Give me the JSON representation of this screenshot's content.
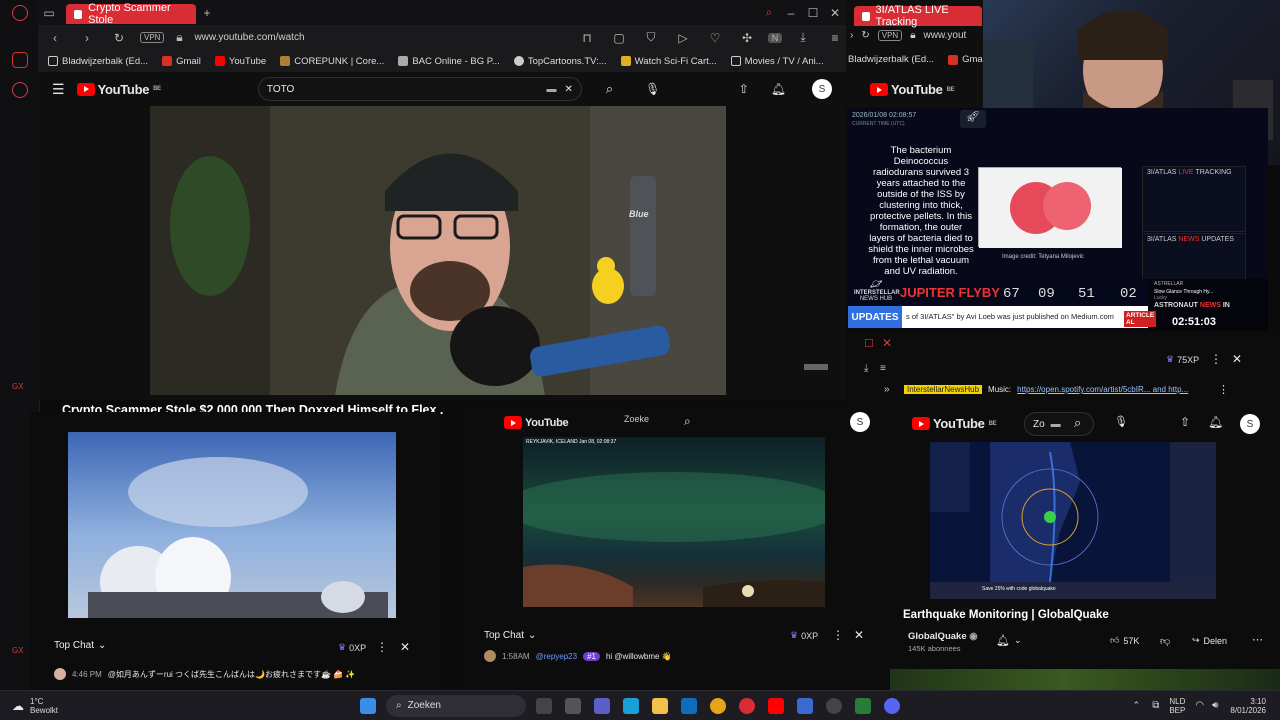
{
  "browser_main": {
    "tab_title": "Crypto Scammer Stole",
    "url": "www.youtube.com/watch",
    "vpn": "VPN",
    "bookmarks": [
      "Bladwijzerbalk (Ed...",
      "Gmail",
      "YouTube",
      "COREPUNK | Core...",
      "BAC Online - BG P...",
      "TopCartoons.TV:...",
      "Watch Sci-Fi Cart...",
      "Movies / TV / Ani..."
    ],
    "search_value": "TOTO",
    "avatar_letter": "S",
    "brand": "YouTube",
    "region": "BE",
    "video_title": "Crypto Scammer Stole $2,000,000 Then Doxxed Himself to Flex..",
    "video_mic_label": "Blue"
  },
  "browser_second": {
    "tab_title": "3I/ATLAS LIVE Tracking",
    "url": "www.yout",
    "bookmarks": [
      "Bladwijzerbalk (Ed...",
      "Gmail"
    ],
    "brand": "YouTube",
    "region": "BE"
  },
  "news_hub": {
    "timestamp": "2026/01/08 02:08:57",
    "timestamp_sub": "CURRENT TIME (UTC)",
    "fact_text": "The bacterium Deinococcus radiodurans survived 3 years attached to the outside of the ISS by clustering into thick, protective pellets. In this formation, the outer layers of bacteria died to shield the inner microbes from the lethal vacuum and UV radiation.",
    "image_credit": "Image credit: Tetyana Milojevic",
    "side_title_a": "3I/ATLAS",
    "side_live": "LIVE",
    "side_tracking": "TRACKING",
    "side_news_a": "3I/ATLAS",
    "side_news_b": "NEWS",
    "side_news_c": "UPDATES",
    "brand": "INTERSTELLAR",
    "brand_sub": "NEWS HUB",
    "flyby_label": "JUPITER FLYBY",
    "flyby_numbers": [
      "67",
      "09",
      "51",
      "02"
    ],
    "updates_label": "UPDATES",
    "ticker": "s of 3I/ATLAS\" by Avi Loeb was just published on Medium.com",
    "ticker_tag": "ARTICLE AL",
    "astronaut_label_a": "ASTRONAUT",
    "astronaut_label_b": "NEWS",
    "astronaut_label_c": "IN",
    "countdown": "02:51:03",
    "astro_row1": "ASTRELLAR",
    "astro_row2": "Slow Glance Through Hy...",
    "astro_row3": "Lucky"
  },
  "right_tile": {
    "xp": "75XP",
    "music_tag": "InterstellarNewsHub",
    "music_text": "Music:",
    "music_link": "https://open.spotify.com/artist/5cbIR... and http...",
    "search_value": "Zo",
    "brand": "YouTube",
    "region": "BE",
    "avatar_letter": "S",
    "video_title": "Earthquake Monitoring | GlobalQuake",
    "channel": "GlobalQuake",
    "subscribers": "145K abonnees",
    "likes": "57K",
    "share": "Delen",
    "map_promo": "Save 25% with code globalquake"
  },
  "left_tile": {
    "chat_title": "Top Chat",
    "xp": "0XP",
    "chat_time": "4:46 PM",
    "chat_text": "@如月あんずーrui つくば先生こんばんは🌙お疲れさまです☕ 🍰 ✨"
  },
  "middle_tile": {
    "chat_title": "Top Chat",
    "xp": "0XP",
    "chat_time": "1:58AM",
    "chat_user": "@repyep23",
    "chat_badge": "#1",
    "chat_text": "hi @willowbme 👋",
    "search_value": "Zoeke",
    "cam_overlay": "REYKJAVIK, ICELAND   Jan 08, 02:08:37"
  },
  "taskbar": {
    "weather_temp": "1°C",
    "weather_desc": "Bewolkt",
    "search_placeholder": "Zoeken",
    "lang_a": "NLD",
    "lang_b": "BEP",
    "time": "3:10",
    "date": "8/01/2026"
  },
  "colors": {
    "accent": "#d92d36",
    "youtube_red": "#ff0000",
    "news_blue": "#2f6fe0"
  }
}
